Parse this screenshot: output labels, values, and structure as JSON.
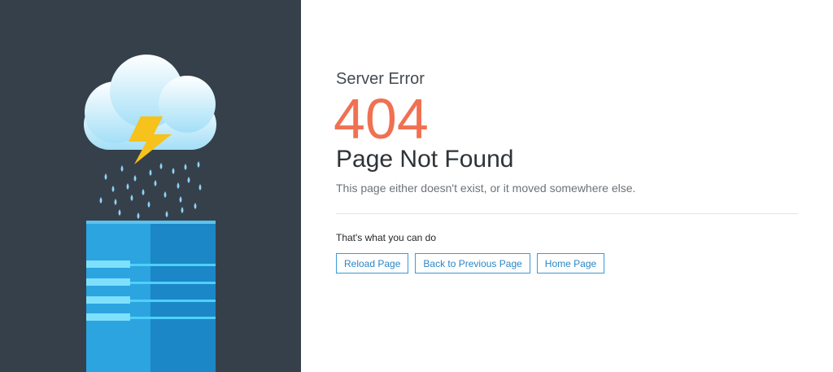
{
  "error": {
    "eyebrow": "Server Error",
    "code": "404",
    "title": "Page Not Found",
    "description": "This page either doesn't exist, or it moved somewhere else."
  },
  "actions": {
    "heading": "That's what you can do",
    "reload_label": "Reload Page",
    "back_label": "Back to Previous Page",
    "home_label": "Home Page"
  },
  "colors": {
    "panel_background": "#36404b",
    "error_code": "#f07152",
    "button_border": "#3a9bd5",
    "button_text": "#2b86c5",
    "lightning": "#f6c21b",
    "rain": "#8fd3f4",
    "server_light": "#2ba4e0",
    "server_dark": "#1b87c7"
  },
  "icons": [
    "storm-cloud-icon",
    "lightning-bolt-icon",
    "rain-drops-icon",
    "server-rack-icon"
  ]
}
